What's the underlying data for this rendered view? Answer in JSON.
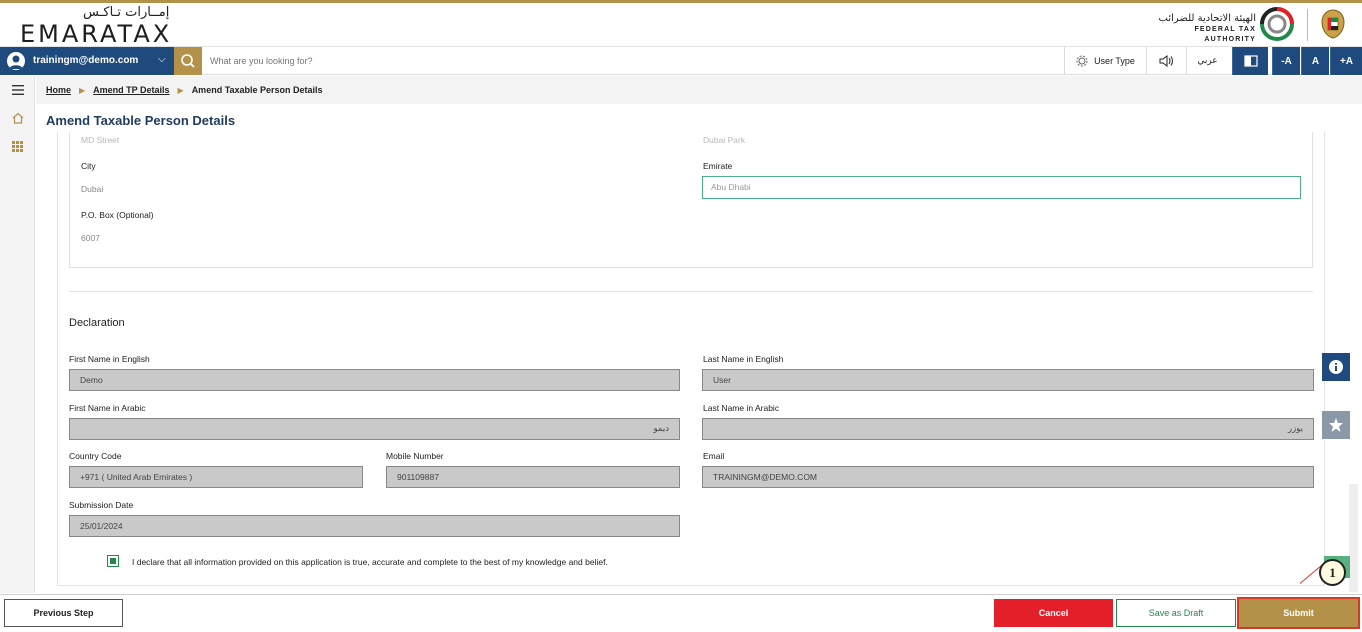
{
  "brand": {
    "logo_ar": "إمــارات تـاكـس",
    "logo_en": "EMARATAX",
    "fta_ar": "الهيئة الاتحادية للضرائب",
    "fta_en": "FEDERAL TAX AUTHORITY"
  },
  "nav": {
    "user_email": "trainingm@demo.com",
    "search_placeholder": "What are you looking for?",
    "user_type": "User Type",
    "arabic": "عربي",
    "font_minus": "-A",
    "font_normal": "A",
    "font_plus": "+A"
  },
  "breadcrumb": {
    "home": "Home",
    "amend_tp": "Amend TP Details",
    "current": "Amend Taxable Person Details"
  },
  "page_title": "Amend Taxable Person Details",
  "address": {
    "street_value": "MD Street",
    "area_value": "Dubai Park",
    "city_label": "City",
    "city_value": "Dubai",
    "emirate_label": "Emirate",
    "emirate_value": "Abu Dhabi",
    "pobox_label": "P.O. Box (Optional)",
    "pobox_value": "6007"
  },
  "declaration": {
    "title": "Declaration",
    "first_name_en_label": "First Name in English",
    "first_name_en": "Demo",
    "last_name_en_label": "Last Name in English",
    "last_name_en": "User",
    "first_name_ar_label": "First Name in Arabic",
    "first_name_ar": "ديمو",
    "last_name_ar_label": "Last Name in Arabic",
    "last_name_ar": "يوزر",
    "country_code_label": "Country Code",
    "country_code": "+971 ( United Arab Emirates )",
    "mobile_label": "Mobile Number",
    "mobile": "901109887",
    "email_label": "Email",
    "email": "TRAININGM@DEMO.COM",
    "submission_date_label": "Submission Date",
    "submission_date": "25/01/2024",
    "statement": "I declare that all information provided on this application is true, accurate and complete to the best of my knowledge and belief."
  },
  "footer": {
    "previous": "Previous Step",
    "cancel": "Cancel",
    "save_draft": "Save as Draft",
    "submit": "Submit"
  },
  "callout": "1",
  "colors": {
    "navy": "#1f4a7d",
    "gold": "#b39149",
    "red": "#e3202a",
    "green": "#1f8a4c"
  }
}
